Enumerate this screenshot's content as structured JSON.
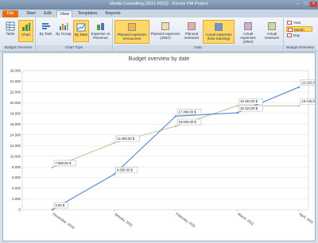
{
  "window": {
    "title": "Media Consulting (2011-0012) - Excom PM Project"
  },
  "menu": {
    "file": "File",
    "tabs": [
      "Start",
      "Edit",
      "View",
      "Templates",
      "Reports"
    ],
    "active_tab": "View"
  },
  "ribbon": {
    "groups": [
      "Budget Overview",
      "Chart Type",
      "Data",
      "Budget Overview"
    ],
    "overview_buttons": [
      {
        "label": "Table",
        "selected": false
      },
      {
        "label": "Chart",
        "selected": true
      }
    ],
    "chart_type_buttons": [
      {
        "label": "By Task",
        "selected": false
      },
      {
        "label": "By Group",
        "selected": false
      },
      {
        "label": "By Date",
        "selected": true
      },
      {
        "label": "Expense vs Revenue",
        "selected": false
      }
    ],
    "data_buttons": [
      {
        "label": "Planned expenses (resources)",
        "color": "#f4b74a",
        "selected": true
      },
      {
        "label": "Planned expenses (other)",
        "color": "#f7d9a6",
        "selected": false
      },
      {
        "label": "Planned revenues",
        "color": "#f3a9a9",
        "selected": false
      },
      {
        "label": "Actual expenses (time tracking)",
        "color": "#6d97cd",
        "selected": true
      },
      {
        "label": "Actual expenses (other)",
        "color": "#d7a8d4",
        "selected": false
      },
      {
        "label": "Actual revenues",
        "color": "#c7dca0",
        "selected": false
      }
    ],
    "period_buttons": [
      {
        "label": "Year",
        "selected": false
      },
      {
        "label": "Month",
        "selected": true
      },
      {
        "label": "Day",
        "selected": false
      }
    ]
  },
  "colors": {
    "actual": "#5b8fd6",
    "planned": "#b5b88d",
    "accent": "#ffd86a"
  },
  "chart_data": {
    "type": "line",
    "title": "Budget overview by date",
    "categories": [
      "December, 2010",
      "January, 2011",
      "February, 2011",
      "March, 2011",
      "April, 2011"
    ],
    "ylim": [
      0,
      26000
    ],
    "yticks": [
      "0",
      "2.000",
      "4.000",
      "6.000",
      "8.000",
      "10.000",
      "12.000",
      "14.000",
      "16.000",
      "18.000",
      "20.000",
      "22.000",
      "24.000",
      "26.000"
    ],
    "series": [
      {
        "key": "actual",
        "values": [
          0,
          6600,
          17480,
          18120,
          22920
        ],
        "labels": [
          "0,00 $",
          "6.600,00 $",
          "17.480,00 $",
          "18.120,00 $",
          "22.920,00 $"
        ]
      },
      {
        "key": "planned",
        "values": [
          7880,
          12480,
          15600,
          19440,
          19440
        ],
        "labels": [
          "7.880,00 $",
          "12.480,00 $",
          "15.600,00 $",
          "19.440,00 $",
          "19.440,00 $"
        ]
      }
    ],
    "grid": true
  }
}
